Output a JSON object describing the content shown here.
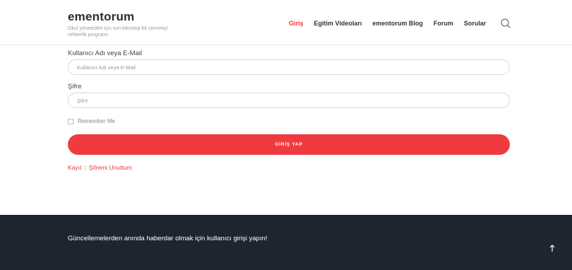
{
  "brand": {
    "name": "ementorum",
    "tagline": "Okul yöneticileri için son teknoloji bir çevrimiçi rehberlik programı"
  },
  "nav": {
    "items": [
      "Giriş",
      "Egitim Videoları",
      "ementorum Blog",
      "Forum",
      "Sorular"
    ],
    "active_index": 0,
    "active_color": "#e8383d",
    "search_icon": "search-icon"
  },
  "login_form": {
    "username_label": "Kullanıcı Adı veya E-Mail",
    "username_placeholder": "Kullanıcı Adı veya E-Mail",
    "password_label": "Şifre",
    "password_placeholder": "Şifre",
    "remember_label": "Remember Me",
    "remember_checked": false,
    "submit_label": "GİRİŞ YAP",
    "submit_color": "#ef3b3f"
  },
  "links": {
    "register": "Kayıt",
    "separator": "|",
    "forgot": "Şifremi Unuttum"
  },
  "footer": {
    "message": "Güncellemelerden anında haberdar olmak için kullanıcı girişi yapın!",
    "background": "#1f2431",
    "scroll_top_icon": "arrow-up-icon"
  }
}
